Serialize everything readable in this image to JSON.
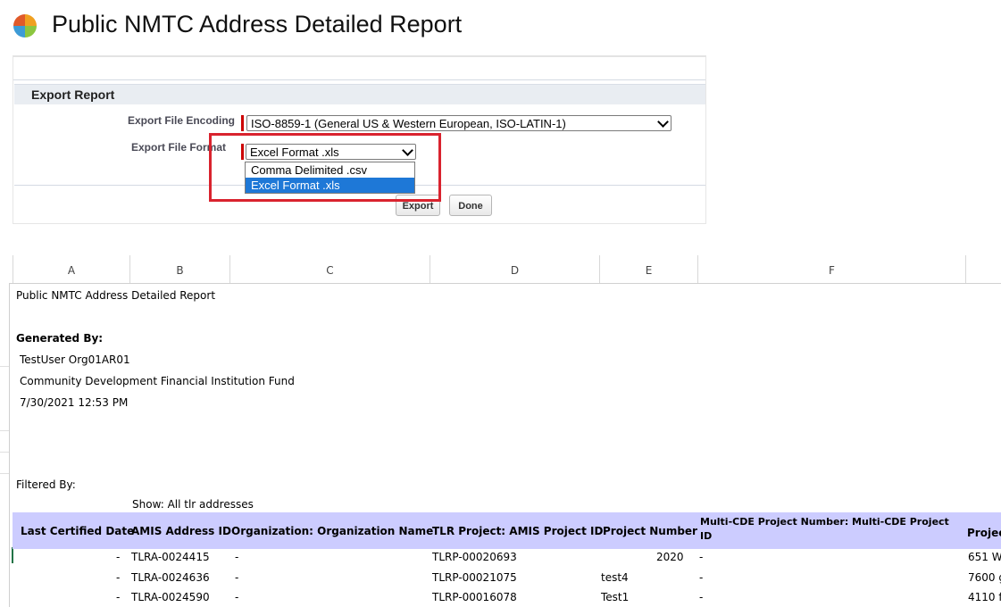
{
  "page": {
    "title": "Public NMTC Address Detailed Report"
  },
  "export_panel": {
    "section_title": "Export Report",
    "encoding": {
      "label": "Export File Encoding",
      "value": "ISO-8859-1 (General US & Western European, ISO-LATIN-1)"
    },
    "format": {
      "label": "Export File Format",
      "value": "Excel Format .xls",
      "options": [
        "Comma Delimited .csv",
        "Excel Format .xls"
      ],
      "selected_option": "Excel Format .xls"
    },
    "export_button": "Export",
    "done_button": "Done",
    "highlight_color": "#d9232e"
  },
  "spreadsheet": {
    "columns": [
      "A",
      "B",
      "C",
      "D",
      "E",
      "F"
    ],
    "report_title": "Public NMTC Address Detailed Report",
    "generated_by_label": "Generated By:",
    "user": "TestUser Org01AR01",
    "organization": "Community Development Financial Institution Fund",
    "timestamp": "7/30/2021 12:53 PM",
    "filtered_by_label": "Filtered By:",
    "filter_value": "Show: All tlr addresses",
    "header_bg": "#ccccff",
    "table_headers": {
      "last_certified_date": "Last Certified Date",
      "amis_address_id": "AMIS Address ID",
      "organization_name": "Organization: Organization Name",
      "tlr_project_amis_id": "TLR Project: AMIS Project ID",
      "project_number": "Project Number",
      "multi_cde_line1": "Multi-CDE Project Number: Multi-CDE Project",
      "multi_cde_line2": "ID",
      "project_address_partial": "Projec"
    },
    "rows": [
      {
        "last_certified_date": "-",
        "amis_address_id": "TLRA-0024415",
        "organization_name": "-",
        "tlr_project_amis_id": "TLRP-00020693",
        "project_number": "2020",
        "multi_cde": "-",
        "project_address_partial": "651 W"
      },
      {
        "last_certified_date": "-",
        "amis_address_id": "TLRA-0024636",
        "organization_name": "-",
        "tlr_project_amis_id": "TLRP-00021075",
        "project_number": "test4",
        "multi_cde": "-",
        "project_address_partial": "7600 g"
      },
      {
        "last_certified_date": "-",
        "amis_address_id": "TLRA-0024590",
        "organization_name": "-",
        "tlr_project_amis_id": "TLRP-00016078",
        "project_number": "Test1",
        "multi_cde": "-",
        "project_address_partial": "4110 f"
      }
    ]
  }
}
